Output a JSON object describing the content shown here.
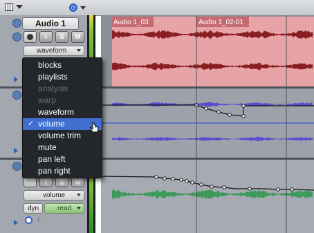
{
  "toolbar": {
    "list_icon": "track-list-icon",
    "timebase_icon": "clock-icon"
  },
  "track1": {
    "name": "Audio 1",
    "buttons": [
      "I",
      "S",
      "M"
    ],
    "view": "waveform"
  },
  "track3": {
    "buttons": [
      "I",
      "S",
      "M"
    ],
    "view": "volume",
    "dyn": "dyn",
    "automation_mode": "read"
  },
  "clips": [
    {
      "name": "Audio 1_03"
    },
    {
      "name": "Audio 1_02-01"
    }
  ],
  "view_menu": {
    "items": [
      {
        "label": "blocks",
        "enabled": true,
        "checked": false,
        "selected": false
      },
      {
        "label": "playlists",
        "enabled": true,
        "checked": false,
        "selected": false
      },
      {
        "label": "analysis",
        "enabled": false,
        "checked": false,
        "selected": false
      },
      {
        "label": "warp",
        "enabled": false,
        "checked": false,
        "selected": false
      },
      {
        "label": "waveform",
        "enabled": true,
        "checked": false,
        "selected": false
      },
      {
        "label": "volume",
        "enabled": true,
        "checked": true,
        "selected": true
      },
      {
        "label": "volume trim",
        "enabled": true,
        "checked": false,
        "selected": false
      },
      {
        "label": "mute",
        "enabled": true,
        "checked": false,
        "selected": false
      },
      {
        "label": "pan left",
        "enabled": true,
        "checked": false,
        "selected": false
      },
      {
        "label": "pan right",
        "enabled": true,
        "checked": false,
        "selected": false
      }
    ],
    "check_mark": "✓"
  },
  "colors": {
    "clip_red": "#e8a3a6",
    "waveform_red": "#8a1f23",
    "waveform_blue": "#5a4ccf",
    "waveform_green": "#3e9a5a",
    "menu_bg": "#23262b",
    "menu_selected": "#3f6fd1"
  }
}
